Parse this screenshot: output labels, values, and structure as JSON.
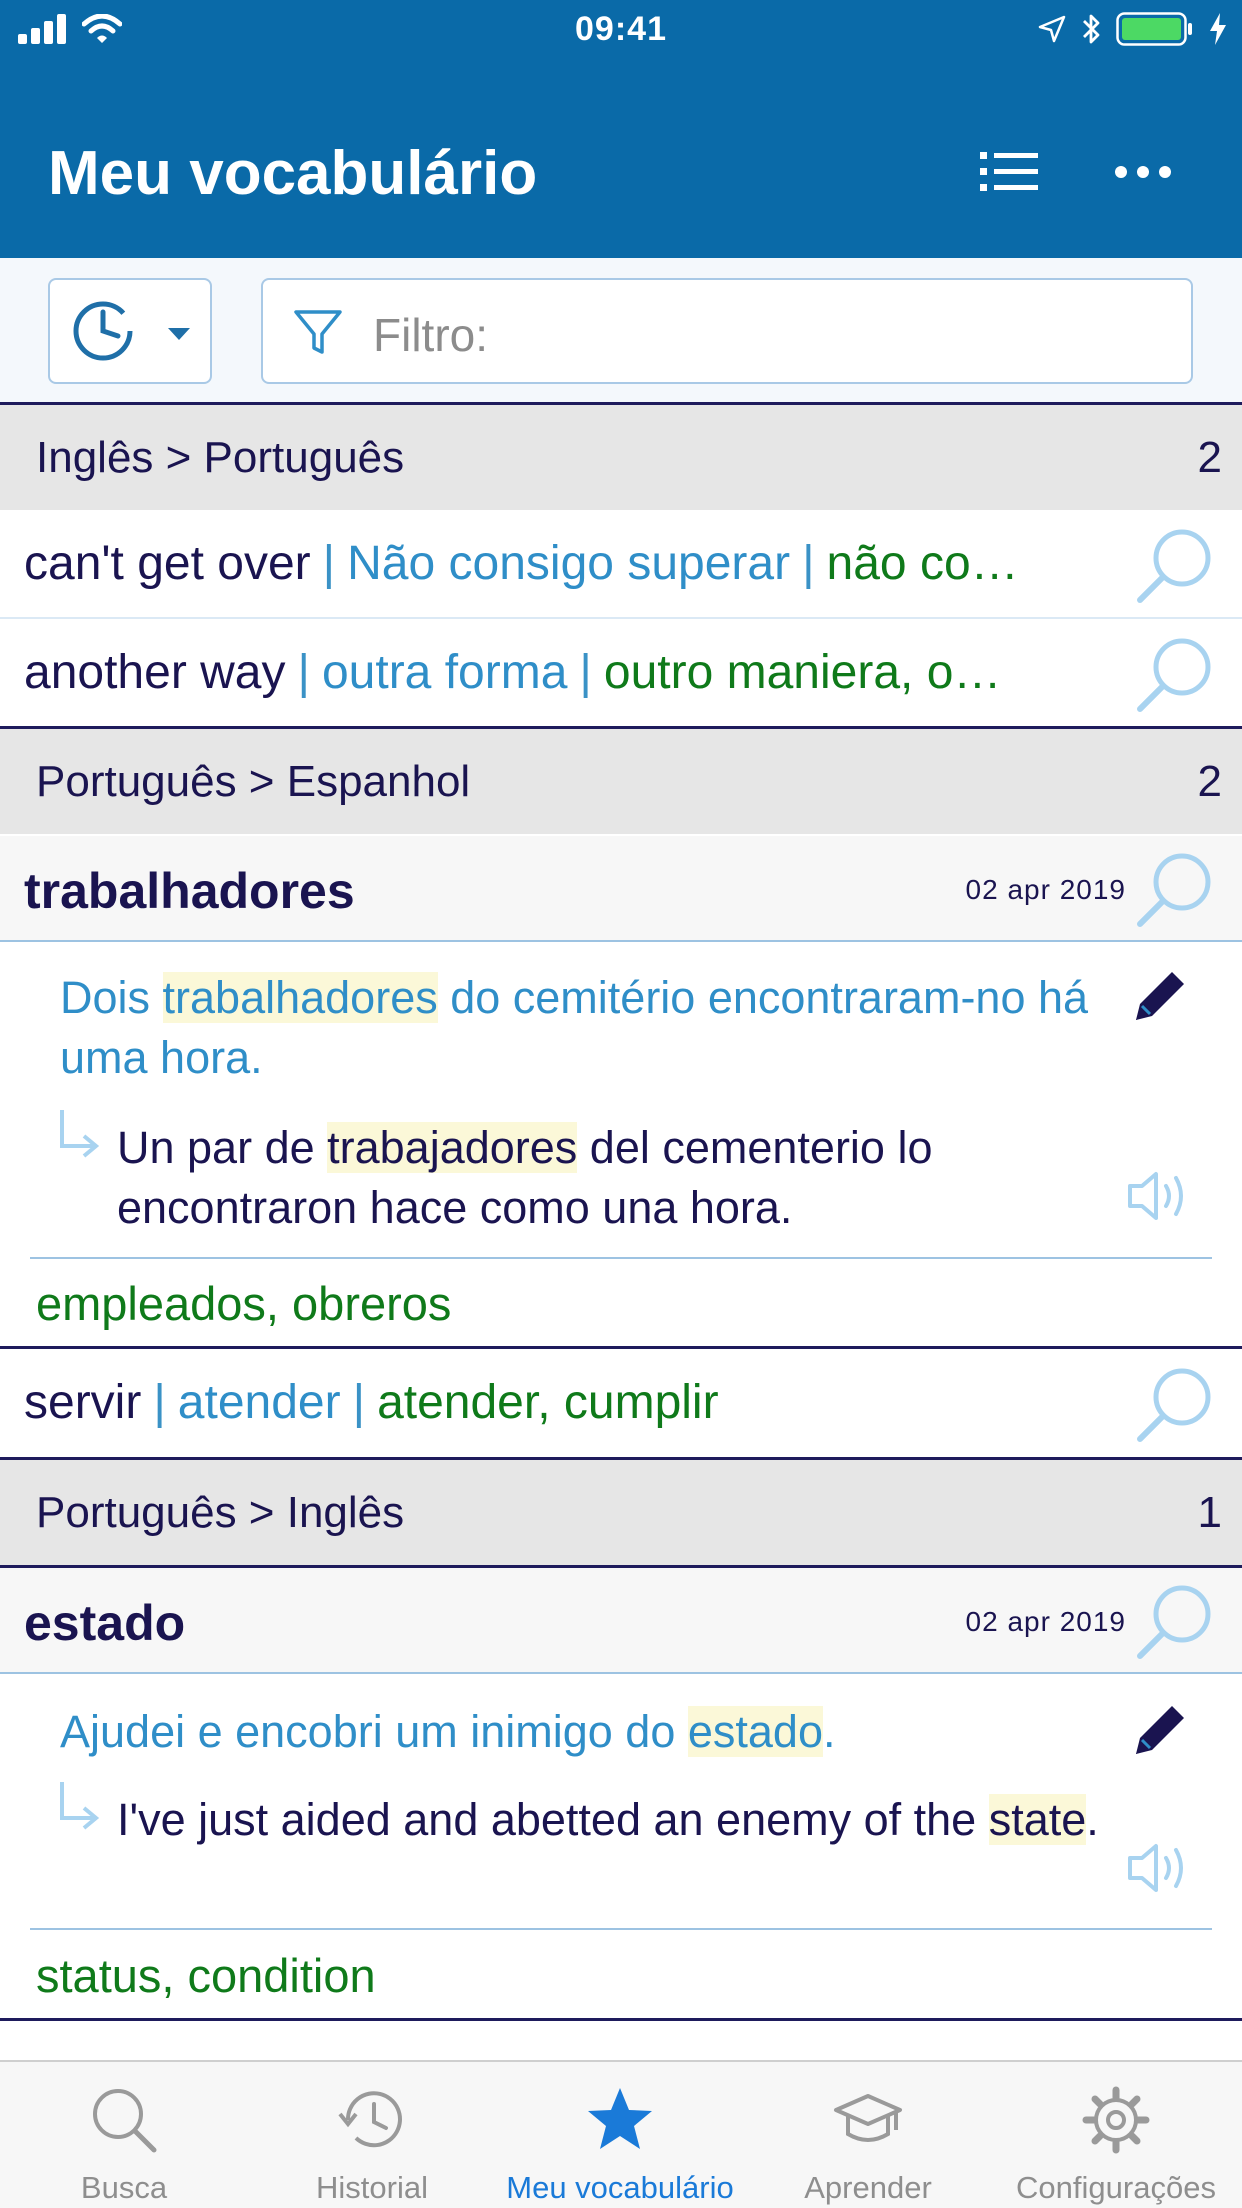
{
  "status_bar": {
    "time": "09:41"
  },
  "header": {
    "title": "Meu vocabulário"
  },
  "filter": {
    "placeholder": "Filtro:"
  },
  "sections": [
    {
      "label": "Inglês > Português",
      "count": "2"
    },
    {
      "label": "Português > Espanhol",
      "count": "2"
    },
    {
      "label": "Português > Inglês",
      "count": "1"
    }
  ],
  "simple_rows": [
    {
      "source": "can't get over",
      "translation": "Não consigo superar",
      "synonyms": "não co…"
    },
    {
      "source": "another way",
      "translation": "outra forma",
      "synonyms": "outro maniera, o…"
    },
    {
      "source": "servir",
      "translation": "atender",
      "synonyms": "atender, cumplir"
    }
  ],
  "entries": [
    {
      "word": "trabalhadores",
      "date": "02 apr 2019",
      "example_before": "Dois ",
      "example_highlight": "trabalhadores",
      "example_after": " do cemitério encontraram-no há uma hora.",
      "translation_before": "Un par de ",
      "translation_highlight": "trabajadores",
      "translation_after": " del cementerio lo encontraron hace como una hora.",
      "synonyms": "empleados, obreros"
    },
    {
      "word": "estado",
      "date": "02 apr 2019",
      "example_before": "Ajudei e encobri um inimigo do ",
      "example_highlight": "estado",
      "example_after": ".",
      "translation_before": "I've just aided and abetted an enemy of the ",
      "translation_highlight": "state",
      "translation_after": ".",
      "synonyms": "status, condition"
    }
  ],
  "tabs": [
    {
      "label": "Busca",
      "icon": "search-icon"
    },
    {
      "label": "Historial",
      "icon": "history-icon"
    },
    {
      "label": "Meu vocabulário",
      "icon": "star-icon",
      "active": true
    },
    {
      "label": "Aprender",
      "icon": "graduation-cap-icon"
    },
    {
      "label": "Configurações",
      "icon": "gear-icon"
    }
  ],
  "colors": {
    "header": "#0a6aa8",
    "source": "#1a1450",
    "translation": "#2f8ec8",
    "synonym": "#0f7a1a",
    "active_tab": "#1a7ad8"
  }
}
